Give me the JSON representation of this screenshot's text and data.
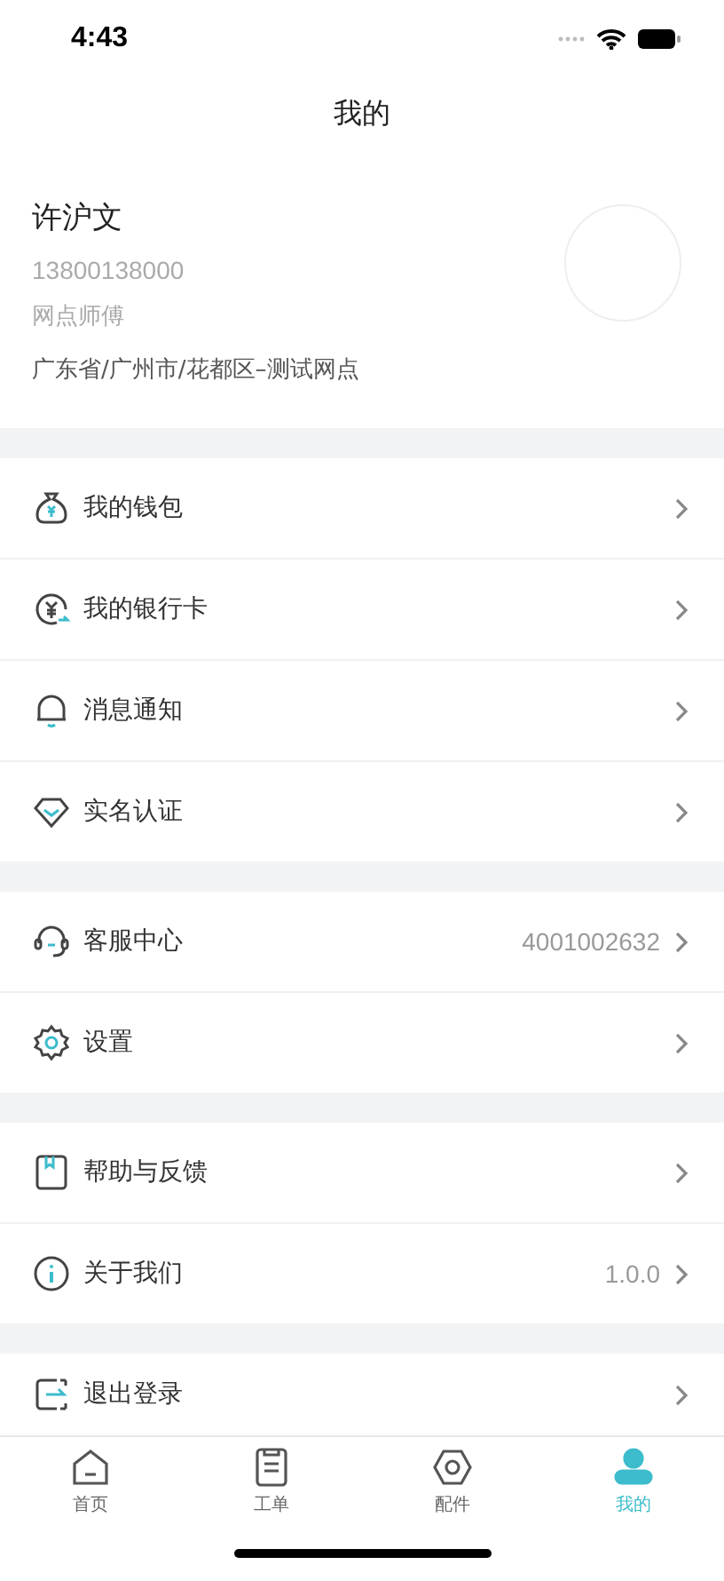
{
  "status_bar": {
    "time": "4:43"
  },
  "header": {
    "title": "我的"
  },
  "profile": {
    "name": "许沪文",
    "phone": "13800138000",
    "role": "网点师傅",
    "location": "广东省/广州市/花都区–测试网点"
  },
  "menu_groups": [
    {
      "items": [
        {
          "label": "我的钱包"
        },
        {
          "label": "我的银行卡"
        },
        {
          "label": "消息通知"
        },
        {
          "label": "实名认证"
        }
      ]
    },
    {
      "items": [
        {
          "label": "客服中心",
          "value": "4001002632"
        },
        {
          "label": "设置"
        }
      ]
    },
    {
      "items": [
        {
          "label": "帮助与反馈"
        },
        {
          "label": "关于我们",
          "value": "1.0.0"
        }
      ]
    },
    {
      "items": [
        {
          "label": "退出登录"
        }
      ]
    }
  ],
  "tab_bar": [
    {
      "label": "首页",
      "selected": false
    },
    {
      "label": "工单",
      "selected": false
    },
    {
      "label": "配件",
      "selected": false
    },
    {
      "label": "我的",
      "selected": true
    }
  ]
}
